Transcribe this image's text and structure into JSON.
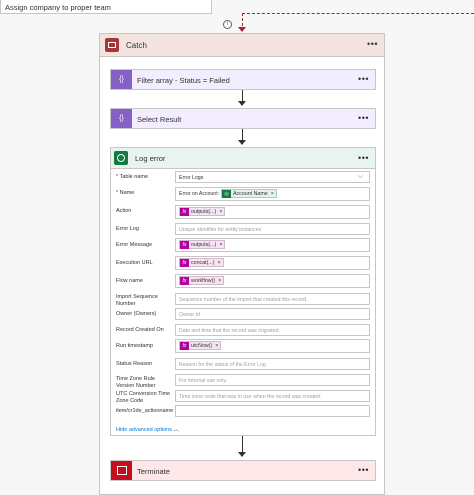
{
  "top_card": {
    "label": "Assign company to proper team"
  },
  "catch": {
    "title": "Catch",
    "menu": "•••"
  },
  "actions": [
    {
      "title": "Filter array - Status = Failed",
      "icon": "{}",
      "menu": "•••"
    },
    {
      "title": "Select Result",
      "icon": "{}",
      "menu": "•••"
    }
  ],
  "log": {
    "title": "Log error",
    "menu": "•••",
    "fields": [
      {
        "label": "Table name",
        "required": true,
        "value": "Error Logs"
      },
      {
        "label": "Name",
        "required": true,
        "value": "Error on Account:",
        "token": "Account Name"
      },
      {
        "label": "Action",
        "token": "outputs(...)"
      },
      {
        "label": "Error Log",
        "placeholder": "Unique identifier for entity instances"
      },
      {
        "label": "Error Message",
        "token": "outputs(...)"
      },
      {
        "label": "Execution URL",
        "token": "concat(...)"
      },
      {
        "label": "Flow name",
        "token": "workflow()"
      },
      {
        "label": "Import Sequence Number",
        "placeholder": "Sequence number of the import that created this record."
      },
      {
        "label": "Owner (Owners)",
        "placeholder": "Owner Id"
      },
      {
        "label": "Record Created On",
        "placeholder": "Date and time that the record was migrated."
      },
      {
        "label": "Run timestamp",
        "token": "utcNow()"
      },
      {
        "label": "Status Reason",
        "placeholder": "Reason for the status of the Error Log"
      },
      {
        "label": "Time Zone Rule Version Number",
        "placeholder": "For internal use only."
      },
      {
        "label": "UTC Conversion Time Zone Code",
        "placeholder": "Time zone code that was in use when the record was created."
      },
      {
        "label": "item/cr1de_actionname",
        "placeholder": ""
      }
    ],
    "advanced": "Hide advanced options"
  },
  "terminate": {
    "title": "Terminate",
    "menu": "•••"
  },
  "info_icon": "i",
  "token_x": "×",
  "chevron": "⌵",
  "fx": "fx"
}
